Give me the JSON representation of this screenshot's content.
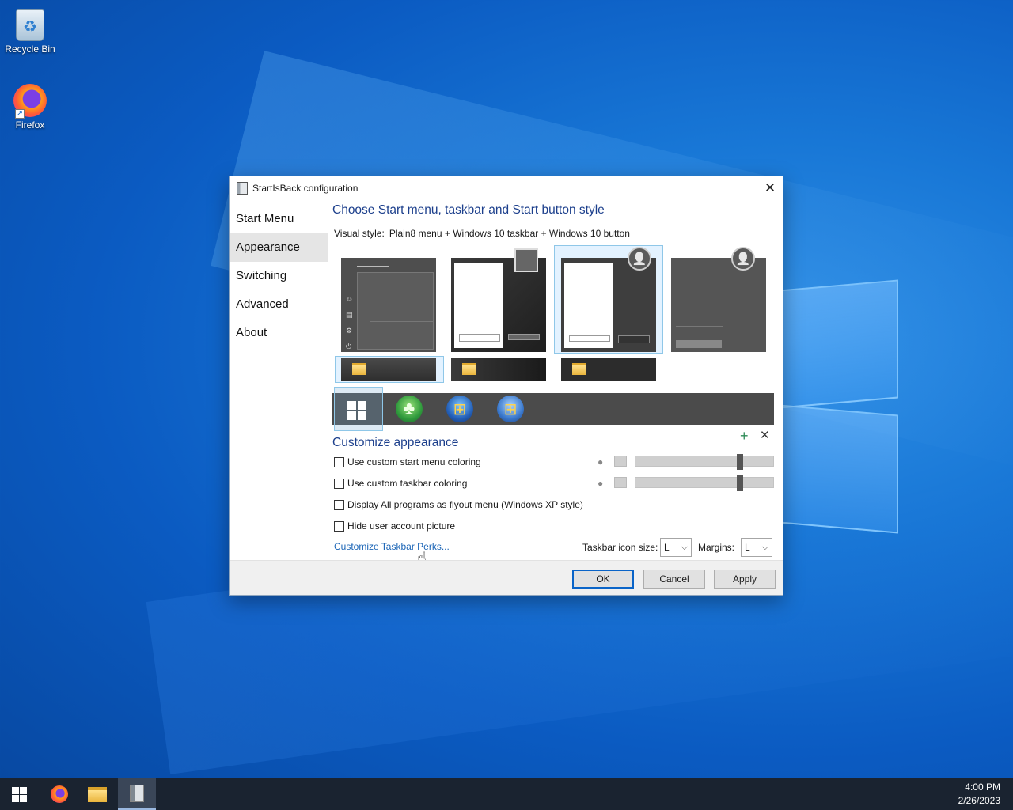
{
  "desktop": {
    "icons": [
      {
        "label": "Recycle Bin",
        "icon": "recycle-bin-icon"
      },
      {
        "label": "Firefox",
        "icon": "firefox-icon"
      }
    ]
  },
  "dialog": {
    "title": "StartIsBack configuration",
    "nav": [
      "Start Menu",
      "Appearance",
      "Switching",
      "Advanced",
      "About"
    ],
    "active_nav": "Appearance",
    "heading": "Choose Start menu, taskbar and Start button style",
    "visual_style_label": "Visual style:",
    "visual_style_value": "Plain8 menu + Windows 10 taskbar + Windows 10 button",
    "customize_heading": "Customize appearance",
    "checkboxes": [
      {
        "label": "Use custom start menu coloring",
        "checked": false
      },
      {
        "label": "Use custom taskbar coloring",
        "checked": false
      },
      {
        "label": "Display All programs as flyout menu (Windows XP style)",
        "checked": false
      },
      {
        "label": "Hide user account picture",
        "checked": false
      }
    ],
    "sliders": [
      0.77,
      0.77
    ],
    "link": "Customize Taskbar Perks...",
    "taskbar_icon_size_label": "Taskbar icon size:",
    "taskbar_icon_size_value": "L",
    "margins_label": "Margins:",
    "margins_value": "L",
    "buttons": {
      "ok": "OK",
      "cancel": "Cancel",
      "apply": "Apply"
    }
  },
  "taskbar": {
    "time": "4:00 PM",
    "date": "2/26/2023"
  },
  "colors": {
    "accent": "#0a64c8",
    "heading": "#1c3f8c",
    "link": "#1a64b6",
    "taskbar": "#1a2330"
  }
}
